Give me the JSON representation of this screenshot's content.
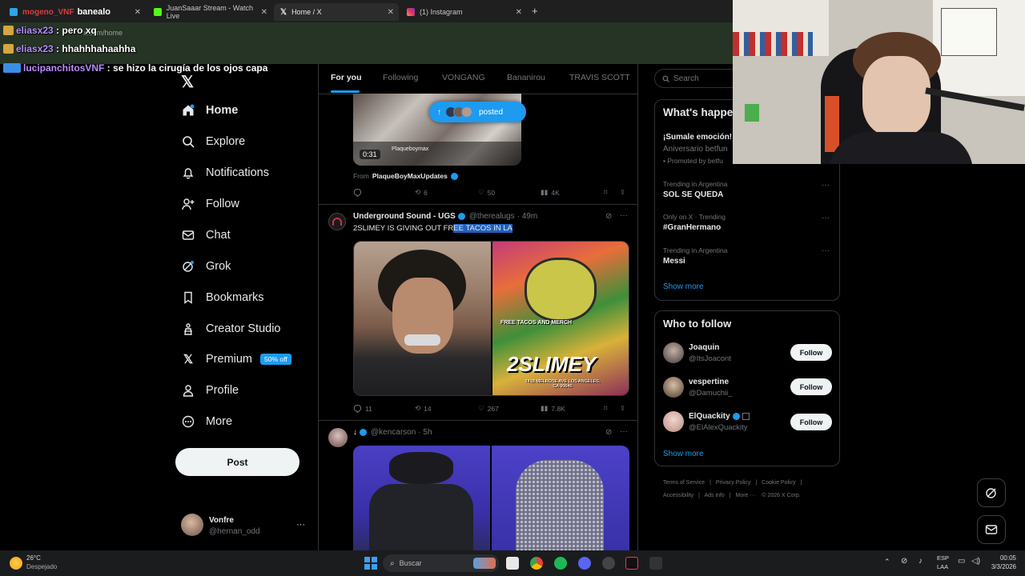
{
  "browser": {
    "tabs": [
      {
        "label": "banealo",
        "prefix_overlay": "mogeno_VNF"
      },
      {
        "label": "JuanSaaar Stream - Watch Live"
      },
      {
        "label": "Home / X"
      },
      {
        "label": "(1) Instagram"
      }
    ],
    "new_tab": "+",
    "url": "x.com/home"
  },
  "chat": [
    {
      "user": "eliasx23",
      "sep": " : ",
      "msg": "pero xq"
    },
    {
      "user": "eliasx23",
      "sep": " : ",
      "msg": "hhahhhahaahha"
    },
    {
      "user": "lucipanchitosVNF",
      "sep": " : ",
      "msg": "se hizo la cirugía de los ojos capa"
    }
  ],
  "nav": {
    "items": [
      {
        "label": "Home",
        "icon": "home-icon"
      },
      {
        "label": "Explore",
        "icon": "search-icon"
      },
      {
        "label": "Notifications",
        "icon": "bell-icon"
      },
      {
        "label": "Follow",
        "icon": "person-add-icon"
      },
      {
        "label": "Chat",
        "icon": "mail-icon"
      },
      {
        "label": "Grok",
        "icon": "grok-icon"
      },
      {
        "label": "Bookmarks",
        "icon": "bookmark-icon"
      },
      {
        "label": "Creator Studio",
        "icon": "creator-icon"
      },
      {
        "label": "Premium",
        "icon": "x-icon"
      },
      {
        "label": "Profile",
        "icon": "person-icon"
      },
      {
        "label": "More",
        "icon": "more-circle-icon"
      }
    ],
    "premium_badge": "50% off",
    "post_label": "Post",
    "account": {
      "name": "Vonfre",
      "handle": "@hernan_odd",
      "more": "···"
    }
  },
  "feed": {
    "tabs": [
      "For you",
      "Following",
      "VONGANG",
      "Bananirou",
      "TRAVIS SCOTT"
    ],
    "posted_pill": "posted",
    "posted_arrow": "↑",
    "post1": {
      "video_time": "0:31",
      "overlay_text": "Plaqueboymax",
      "from_label": "From",
      "from_user": "PlaqueBoyMaxUpdates",
      "stats": {
        "replies": "",
        "reposts": "6",
        "likes": "50",
        "views": "4K"
      }
    },
    "post2": {
      "name": "Underground Sound - UGS",
      "handle": "@therealugs",
      "time": "· 49m",
      "text_plain": "2SLIMEY IS GIVING OUT FR",
      "text_selected": "EE TACOS IN LA",
      "stats": {
        "replies": "11",
        "reposts": "14",
        "likes": "267",
        "views": "7.8K"
      },
      "poster_title": "2SLIMEY",
      "poster_sub": "FREE TACOS AND MERCH",
      "poster_addr": "7418 MELROSE AVE LOS ANGELES, CA 90046"
    },
    "post3": {
      "name": "↓",
      "handle": "@kencarson",
      "time": "· 5h"
    }
  },
  "right": {
    "search_placeholder": "Search",
    "happening": {
      "title": "What's happe",
      "promo_title": "¡Sumale emoción!",
      "promo_sub": "Aniversario betfun",
      "promo_by": "Promoted by betfu",
      "trends": [
        {
          "context": "Trending in Argentina",
          "name": "SOL SE QUEDA"
        },
        {
          "context": "Only on X · Trending",
          "name": "#GranHermano"
        },
        {
          "context": "Trending in Argentina",
          "name": "Messi"
        }
      ],
      "show_more": "Show more"
    },
    "who_to_follow": {
      "title": "Who to follow",
      "users": [
        {
          "name": "Joaquin",
          "handle": "@ItsJoacont",
          "btn": "Follow"
        },
        {
          "name": "vespertine",
          "handle": "@Damuchii_",
          "btn": "Follow"
        },
        {
          "name": "ElQuackity",
          "handle": "@ElAlexQuackity",
          "btn": "Follow"
        }
      ],
      "show_more": "Show more"
    },
    "footer": {
      "line1": [
        "Terms of Service",
        "|",
        "Privacy Policy",
        "|",
        "Cookie Policy",
        "|"
      ],
      "line2": [
        "Accessibility",
        "|",
        "Ads info",
        "|",
        "More ···",
        "© 2026 X Corp."
      ]
    }
  },
  "taskbar": {
    "weather_temp": "26°C",
    "weather_desc": "Despejado",
    "search_placeholder": "Buscar",
    "lang_top": "ESP",
    "lang_bottom": "LAA",
    "time": "00:05",
    "date": "3/3/2026"
  },
  "colors": {
    "accent": "#1d9bf0",
    "selection": "#1f5fbf",
    "chat_name": "#b88cff",
    "address_bar": "#263426",
    "premium_badge": "#1d9bf0"
  }
}
